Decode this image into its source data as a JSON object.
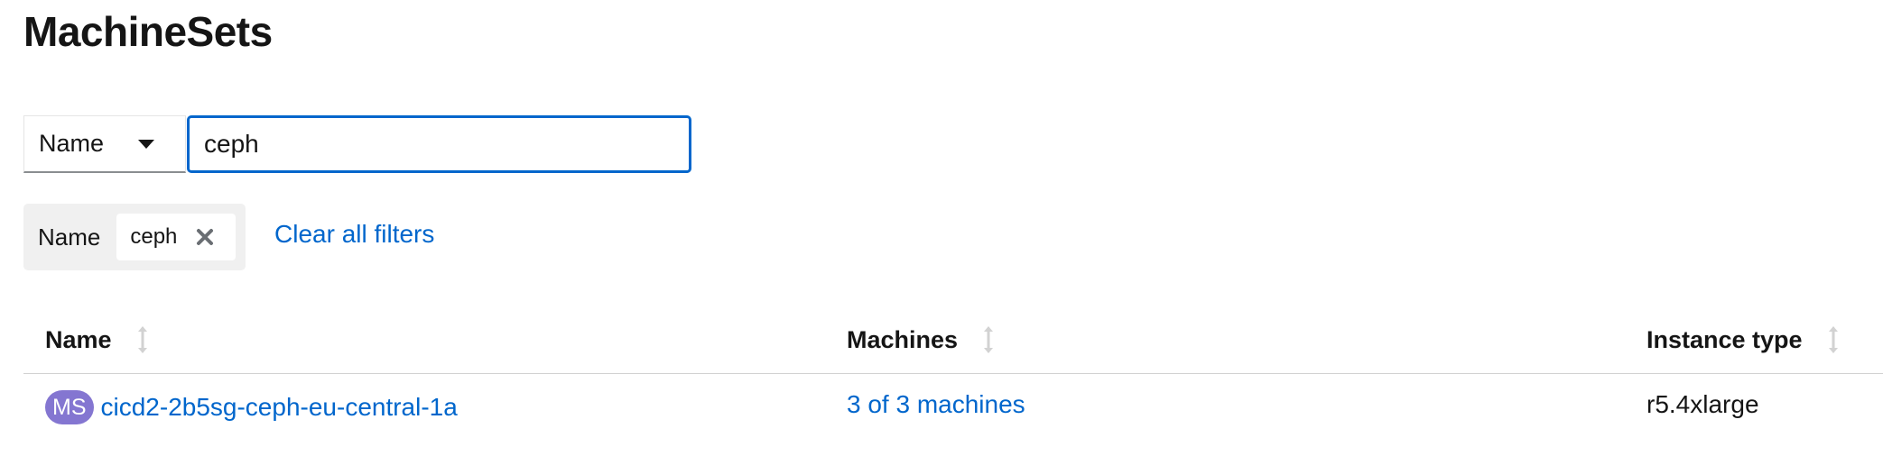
{
  "page": {
    "title": "MachineSets"
  },
  "filter": {
    "type_label": "Name",
    "caret_icon": "caret-down-icon",
    "search_value": "ceph"
  },
  "chips": {
    "group_label": "Name",
    "items": [
      {
        "label": "ceph",
        "close_icon": "close-icon"
      }
    ],
    "clear_all_label": "Clear all filters"
  },
  "table": {
    "columns": [
      {
        "label": "Name",
        "sort_icon": "sort-icon"
      },
      {
        "label": "Machines",
        "sort_icon": "sort-icon"
      },
      {
        "label": "Instance type",
        "sort_icon": "sort-icon"
      }
    ],
    "rows": [
      {
        "badge": "MS",
        "name": "cicd2-2b5sg-ceph-eu-central-1a",
        "machines": "3 of 3 machines",
        "instance_type": "r5.4xlarge"
      }
    ]
  },
  "colors": {
    "link": "#0066cc",
    "badge": "#8476d1",
    "focus_border": "#0066cc"
  }
}
